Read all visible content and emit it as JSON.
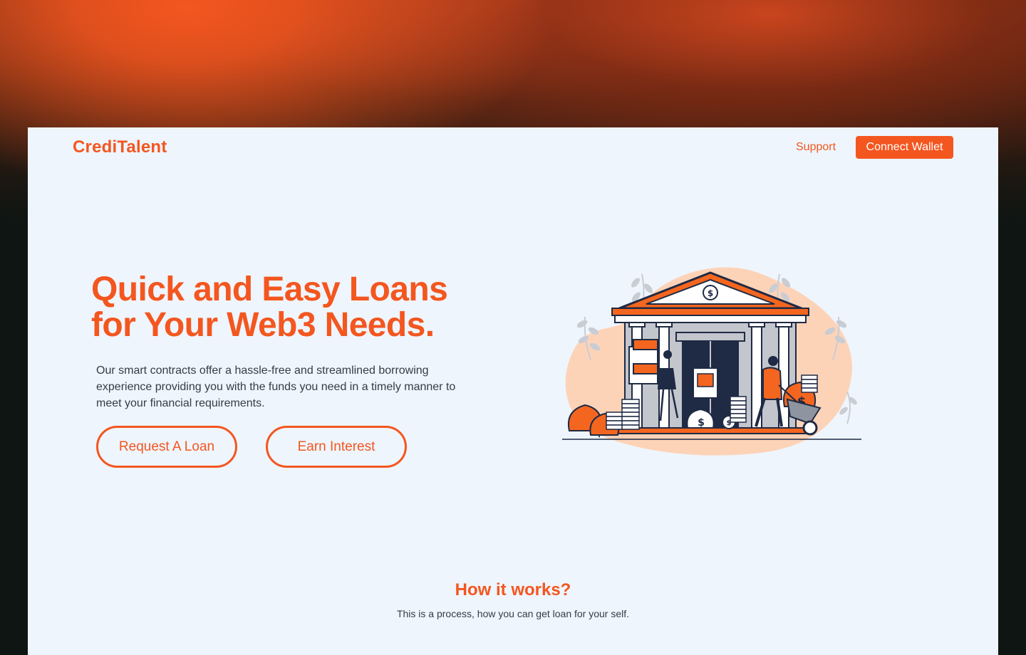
{
  "header": {
    "logo": "CrediTalent",
    "support_label": "Support",
    "connect_wallet_label": "Connect Wallet"
  },
  "hero": {
    "title_line1": "Quick and Easy Loans",
    "title_line2": "for Your Web3 Needs.",
    "description": "Our smart contracts offer a hassle-free and streamlined borrowing experience providing you with the funds you need in a timely manner to meet your financial requirements.",
    "request_loan_label": "Request A Loan",
    "earn_interest_label": "Earn Interest"
  },
  "how_it_works": {
    "title": "How it works?",
    "subtitle": "This is a process, how you can get loan for your self."
  },
  "colors": {
    "accent": "#f4561f",
    "page_background": "#eef5fd",
    "text": "#333c47",
    "illustration_blob": "#fdd3b8",
    "illustration_dark": "#1f2a44"
  },
  "icons": {
    "illustration": "bank-building-with-money-illustration"
  }
}
